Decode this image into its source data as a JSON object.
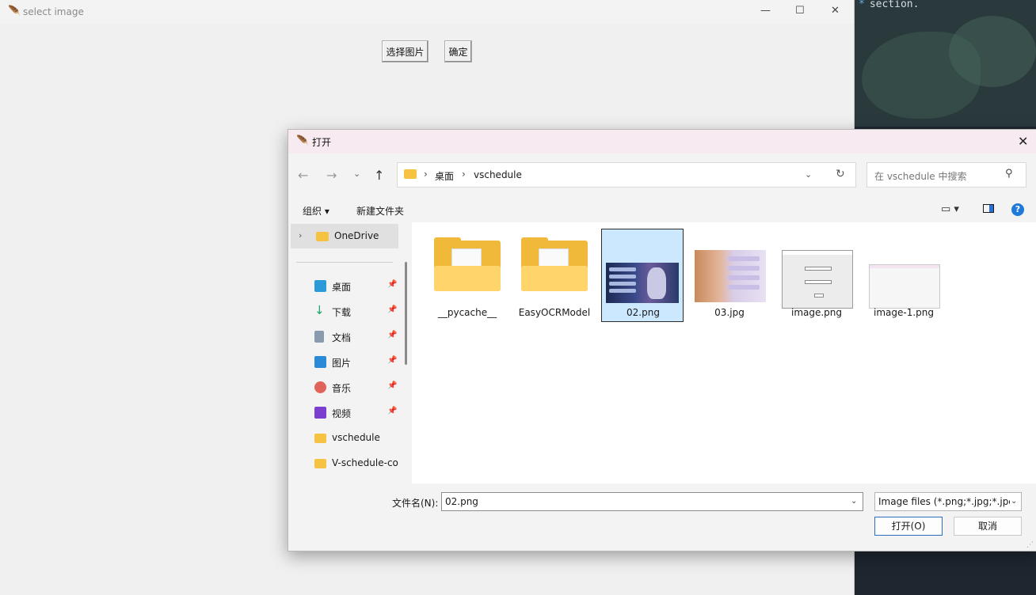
{
  "background_editor": {
    "visible_text": "section.",
    "marker": "*"
  },
  "main_window": {
    "title": "select image",
    "controls": {
      "minimize": "—",
      "maximize": "☐",
      "close": "✕"
    },
    "buttons": {
      "select_image": "选择图片",
      "confirm": "确定"
    }
  },
  "dialog": {
    "title": "打开",
    "close": "✕",
    "nav": {
      "back": "←",
      "forward": "→",
      "history": "⌄",
      "up": "↑"
    },
    "breadcrumb": [
      "桌面",
      "vschedule"
    ],
    "breadcrumb_sep": "›",
    "search_placeholder": "在 vschedule 中搜索",
    "toolbar": {
      "organize": "组织 ▾",
      "new_folder": "新建文件夹",
      "view": "▭ ▾",
      "help": "?"
    },
    "sidebar": {
      "top_item": "OneDrive",
      "items": [
        {
          "label": "桌面",
          "icon": "desktop-icon",
          "color": "#2b9bd8",
          "pinned": true
        },
        {
          "label": "下载",
          "icon": "download-icon",
          "color": "#1aa56b",
          "pinned": true
        },
        {
          "label": "文档",
          "icon": "document-icon",
          "color": "#8a9bb0",
          "pinned": true
        },
        {
          "label": "图片",
          "icon": "pictures-icon",
          "color": "#2a8ad8",
          "pinned": true
        },
        {
          "label": "音乐",
          "icon": "music-icon",
          "color": "#e0645a",
          "pinned": true
        },
        {
          "label": "视频",
          "icon": "video-icon",
          "color": "#7b3fd0",
          "pinned": true
        },
        {
          "label": "vschedule",
          "icon": "folder-icon",
          "color": "#f5c242",
          "pinned": false
        },
        {
          "label": "V-schedule-co",
          "icon": "folder-icon",
          "color": "#f5c242",
          "pinned": false
        }
      ]
    },
    "files": [
      {
        "name": "__pycache__",
        "type": "folder"
      },
      {
        "name": "EasyOCRModel",
        "type": "folder"
      },
      {
        "name": "02.png",
        "type": "image",
        "selected": true
      },
      {
        "name": "03.jpg",
        "type": "image"
      },
      {
        "name": "image.png",
        "type": "image"
      },
      {
        "name": "image-1.png",
        "type": "image"
      }
    ],
    "filename_label": "文件名(N):",
    "filename_value": "02.png",
    "filter_value": "Image files (*.png;*.jpg;*.jpeg",
    "open_button": "打开(O)",
    "cancel_button": "取消"
  }
}
